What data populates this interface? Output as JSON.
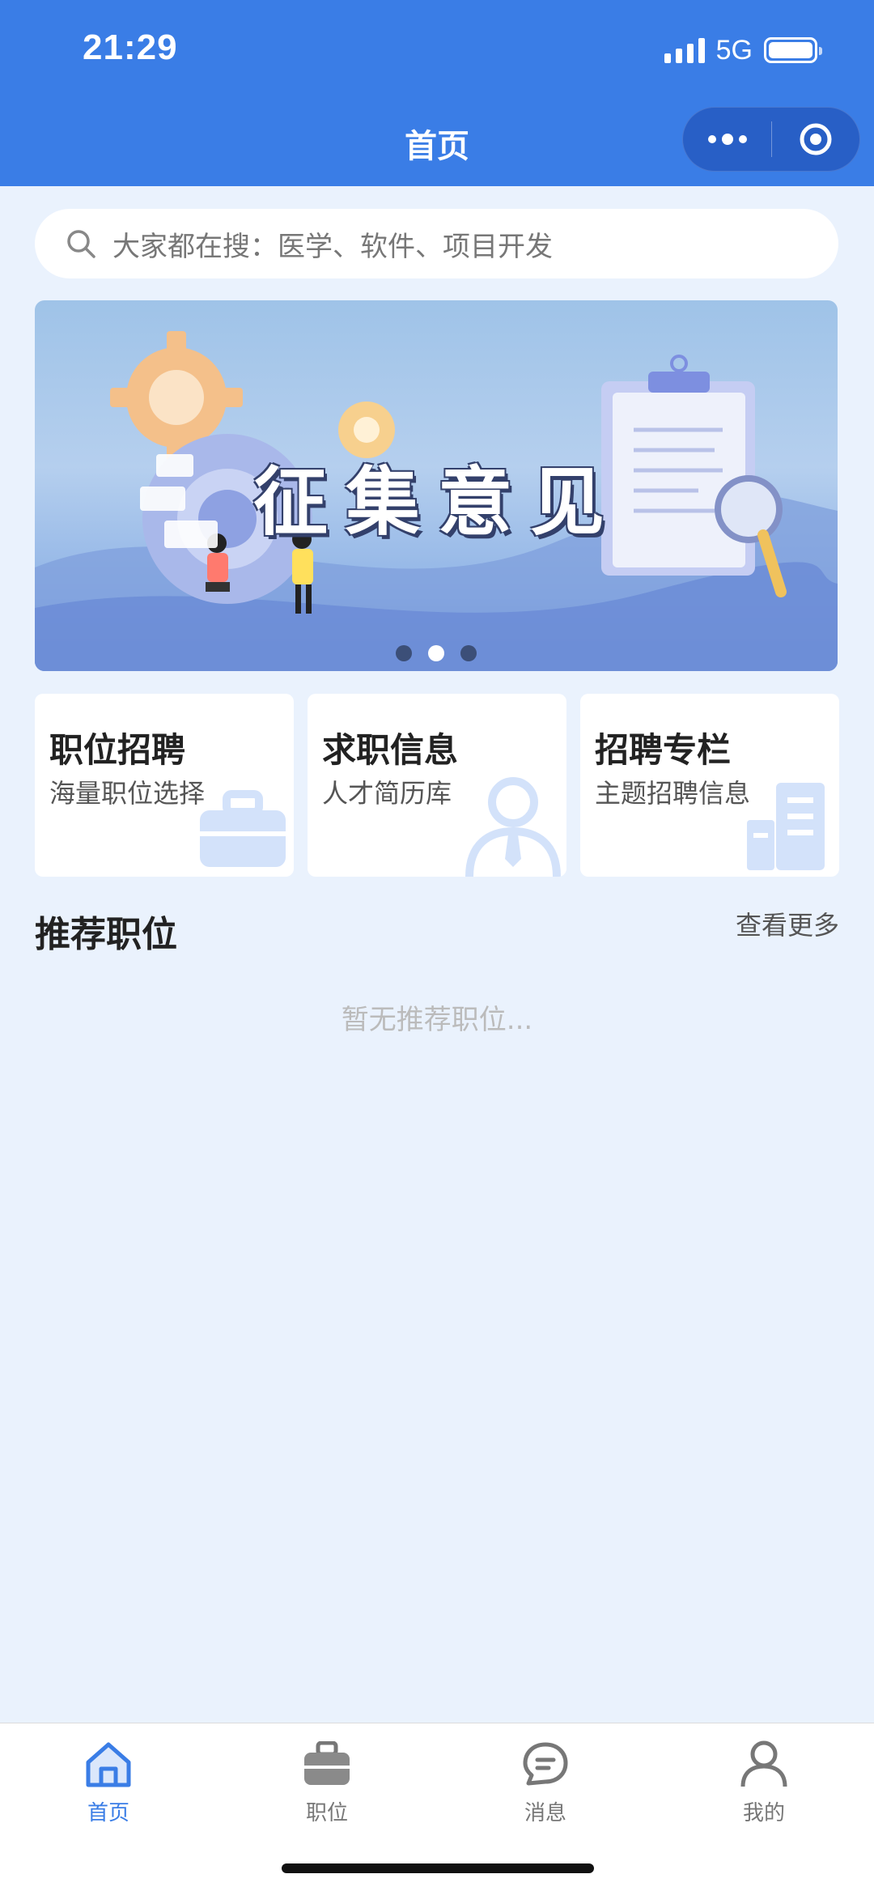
{
  "status": {
    "time": "21:29",
    "network": "5G"
  },
  "nav": {
    "title": "首页"
  },
  "search": {
    "placeholder": "大家都在搜：医学、软件、项目开发"
  },
  "banner": {
    "title": "征集意见",
    "dot_count": 3,
    "active_index": 1
  },
  "cards": [
    {
      "title": "职位招聘",
      "subtitle": "海量职位选择",
      "icon": "briefcase-icon"
    },
    {
      "title": "求职信息",
      "subtitle": "人才简历库",
      "icon": "person-icon"
    },
    {
      "title": "招聘专栏",
      "subtitle": "主题招聘信息",
      "icon": "building-icon"
    }
  ],
  "recommend": {
    "title": "推荐职位",
    "more": "查看更多",
    "empty": "暂无推荐职位..."
  },
  "tabbar": [
    {
      "label": "首页",
      "icon": "home-icon",
      "active": true
    },
    {
      "label": "职位",
      "icon": "briefcase-icon",
      "active": false
    },
    {
      "label": "消息",
      "icon": "message-icon",
      "active": false
    },
    {
      "label": "我的",
      "icon": "user-icon",
      "active": false
    }
  ],
  "colors": {
    "primary": "#3a7de6",
    "background": "#eaf2fd",
    "card_icon": "#dce8fb"
  }
}
